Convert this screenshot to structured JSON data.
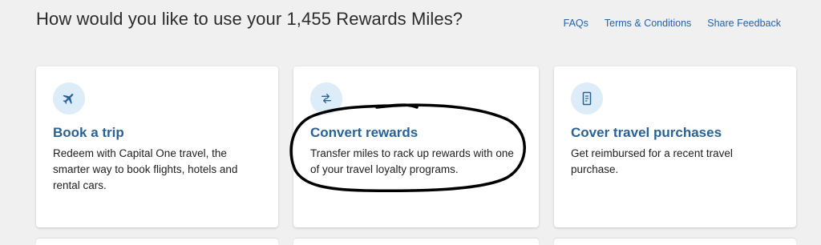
{
  "heading": "How would you like to use your 1,455 Rewards Miles?",
  "links": {
    "faqs": "FAQs",
    "terms": "Terms & Conditions",
    "feedback": "Share Feedback"
  },
  "cards": [
    {
      "icon": "airplane-icon",
      "title": "Book a trip",
      "description": "Redeem with Capital One travel, the smarter way to book flights, hotels and rental cars."
    },
    {
      "icon": "transfer-arrows-icon",
      "title": "Convert rewards",
      "description": "Transfer miles to rack up rewards with one of your travel loyalty programs."
    },
    {
      "icon": "receipt-icon",
      "title": "Cover travel purchases",
      "description": "Get reimbursed for a recent travel purchase."
    }
  ],
  "colors": {
    "accent": "#2a6296",
    "link": "#2563a6",
    "icon_bg": "#dcecf8",
    "page_bg": "#f0f0f0",
    "annotation": "#000000"
  }
}
